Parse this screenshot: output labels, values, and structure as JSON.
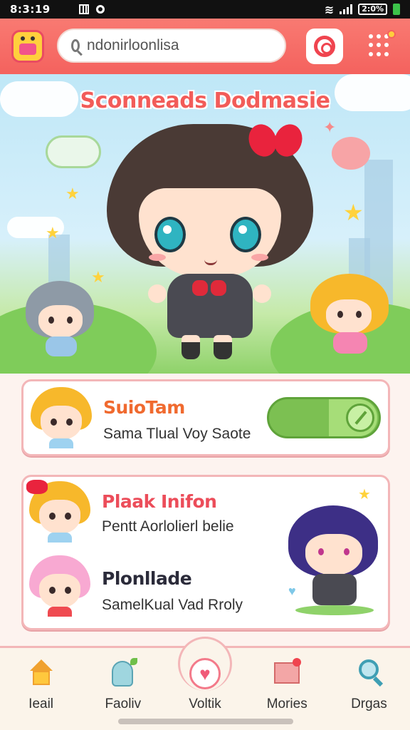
{
  "status_bar": {
    "time": "8:3:19",
    "battery_text": "2:0%"
  },
  "header": {
    "search_placeholder": "ndonirloonlisa"
  },
  "hero": {
    "title": "Sconneads Dodmasie"
  },
  "cards": [
    {
      "title": "SuioTam",
      "subtitle": "Sama Tlual Voy Saote",
      "title_color": "#f06a2f",
      "toggle_on": true
    },
    {
      "title": "Plaak Inifon",
      "subtitle": "Pentt Aorlolierl belie",
      "title_color": "#ec4d5a"
    },
    {
      "title": "Plonllade",
      "subtitle": "SamelKual Vad Rroly",
      "title_color": "#2b2b3a"
    }
  ],
  "nav": {
    "items": [
      {
        "label": "Ieail",
        "icon": "home-icon"
      },
      {
        "label": "Faoliv",
        "icon": "ghost-icon"
      },
      {
        "label": "Voltik",
        "icon": "heart-icon"
      },
      {
        "label": "Mories",
        "icon": "envelope-icon"
      },
      {
        "label": "Drgas",
        "icon": "magnifier-icon"
      }
    ]
  },
  "colors": {
    "header": "#f4625e",
    "accent": "#f0444f",
    "card_border": "#f3b6b8",
    "toggle": "#7cc052"
  }
}
